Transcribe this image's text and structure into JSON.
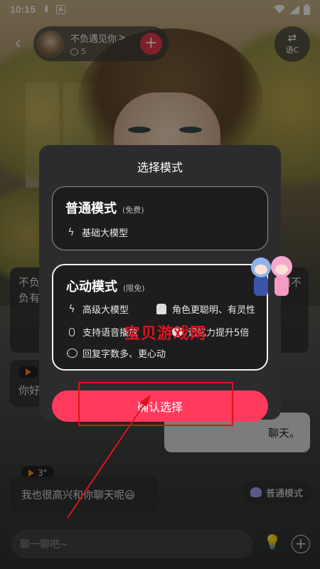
{
  "status_bar": {
    "time": "10:15",
    "notification_glyph": "A"
  },
  "header": {
    "back_icon": "chevron-left-icon",
    "character_name": "不负遇见你",
    "name_suffix": ">",
    "comment_count": "5",
    "add_icon": "plus-icon",
    "voice_button_label": "语C",
    "voice_icon": "switch-arrows-icon"
  },
  "chat": {
    "ai_bubble_1": "不负光负有",
    "right_bubble_1": "阳不",
    "ai_bubble_2": "你好",
    "user_bubble": "聊天。",
    "voice_duration": "3\"",
    "ai_bubble_3": "我也很高兴和你聊天呢😃",
    "mode_chip_label": "普通模式"
  },
  "input": {
    "placeholder": "聊一聊吧~"
  },
  "modal": {
    "title": "选择模式",
    "normal": {
      "name": "普通模式",
      "tag": "(免费)",
      "feature": "基础大模型"
    },
    "heart": {
      "name": "心动模式",
      "tag": "(限免)",
      "features": [
        "高级大模型",
        "角色更聪明、有灵性",
        "支持语音播放",
        "记忆力提升5倍",
        "回复字数多、更心动"
      ]
    },
    "confirm_label": "确认选择"
  },
  "annotations": {
    "watermark": "宝贝游戏网",
    "highlight_color": "#e0121f"
  },
  "colors": {
    "accent": "#ff3a5c",
    "modal_bg": "#2c2c2e",
    "card_bg": "#1d1d1f"
  }
}
